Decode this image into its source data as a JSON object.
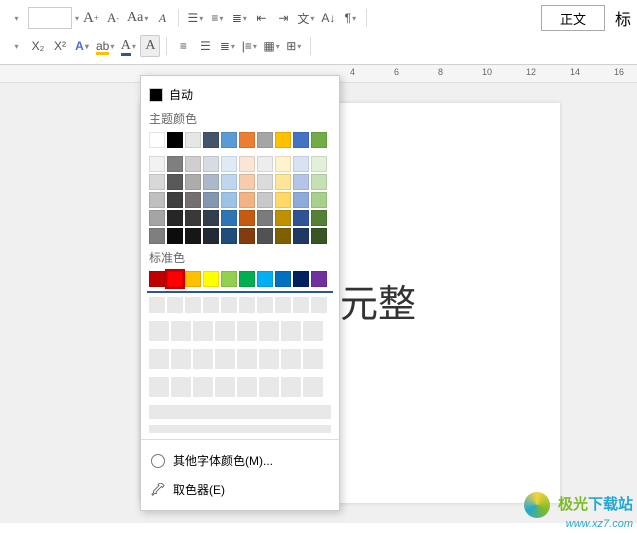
{
  "ribbon": {
    "row1": {
      "font_increase": "A",
      "font_decrease": "A",
      "superscript": "A",
      "change_case": "A",
      "bullets": "•",
      "style_label": "正文",
      "style2_partial": "标"
    },
    "row2": {
      "subscript": "X²",
      "superscript2": "X²",
      "font_style": "A",
      "highlight": "A",
      "font_color": "A",
      "clear_format": "A"
    }
  },
  "ruler": {
    "ticks": [
      "4",
      "6",
      "8",
      "10",
      "12",
      "14",
      "16"
    ]
  },
  "document": {
    "visible_text": "元整"
  },
  "color_panel": {
    "auto_label": "自动",
    "theme_label": "主题颜色",
    "standard_label": "标准色",
    "more_colors": "其他字体颜色(M)...",
    "eyedropper": "取色器(E)",
    "theme_row1": [
      "#ffffff",
      "#000000",
      "#e7e6e6",
      "#44546a",
      "#5b9bd5",
      "#ed7d31",
      "#a5a5a5",
      "#ffc000",
      "#4472c4",
      "#70ad47"
    ],
    "theme_shades": [
      [
        "#f2f2f2",
        "#7f7f7f",
        "#d0cece",
        "#d6dce4",
        "#deebf6",
        "#fbe5d5",
        "#ededed",
        "#fff2cc",
        "#d9e2f3",
        "#e2efd9"
      ],
      [
        "#d8d8d8",
        "#595959",
        "#aeabab",
        "#adb9ca",
        "#bdd7ee",
        "#f7cbac",
        "#dbdbdb",
        "#fee599",
        "#b4c6e7",
        "#c5e0b3"
      ],
      [
        "#bfbfbf",
        "#3f3f3f",
        "#757070",
        "#8496b0",
        "#9cc3e5",
        "#f4b183",
        "#c9c9c9",
        "#ffd965",
        "#8eaadb",
        "#a8d08d"
      ],
      [
        "#a5a5a5",
        "#262626",
        "#3a3838",
        "#323f4f",
        "#2e75b5",
        "#c55a11",
        "#7b7b7b",
        "#bf9000",
        "#2f5496",
        "#538135"
      ],
      [
        "#7f7f7f",
        "#0c0c0c",
        "#171616",
        "#222a35",
        "#1e4e79",
        "#833c0b",
        "#525252",
        "#7f6000",
        "#1f3864",
        "#375623"
      ]
    ],
    "standard_colors": [
      "#c00000",
      "#ff0000",
      "#ffc000",
      "#ffff00",
      "#92d050",
      "#00b050",
      "#00b0f0",
      "#0070c0",
      "#002060",
      "#7030a0"
    ],
    "selected_standard_index": 1
  },
  "watermark": {
    "brand": "极光下载站",
    "url": "www.xz7.com"
  }
}
